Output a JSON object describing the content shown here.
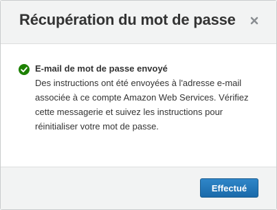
{
  "dialog": {
    "title": "Récupération du mot de passe",
    "close_icon": "close-icon"
  },
  "message": {
    "status_icon": "check-circle-icon",
    "status_color": "#1d8102",
    "heading": "E-mail de mot de passe envoyé",
    "text": "Des instructions ont été envoyées à l'adresse e-mail associée à ce compte Amazon Web Services. Vérifiez cette messagerie et suivez les instructions pour réinitialiser votre mot de passe."
  },
  "footer": {
    "done_label": "Effectué",
    "button_color": "#1f72b5"
  }
}
